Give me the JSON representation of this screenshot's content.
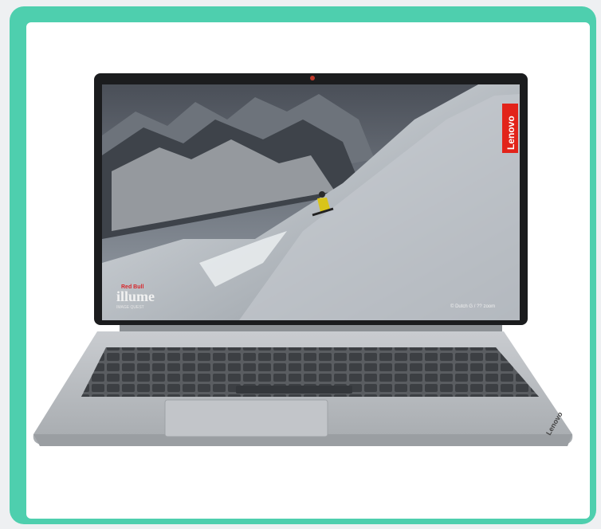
{
  "product": {
    "brand_bezel": "Lenovo",
    "brand_hinge": "Lenovo",
    "wallpaper_badge_line1": "Red Bull",
    "wallpaper_badge_line2": "illume",
    "wallpaper_badge_line3": "IMAGE QUEST",
    "photo_credit": "© Dutch G / ?? zoom"
  },
  "colors": {
    "frame_accent": "#4ecfae",
    "laptop_body": "#b9bcbf",
    "keyboard": "#4a4d51",
    "bezel": "#1b1c1e",
    "brand_red": "#e2231a"
  }
}
